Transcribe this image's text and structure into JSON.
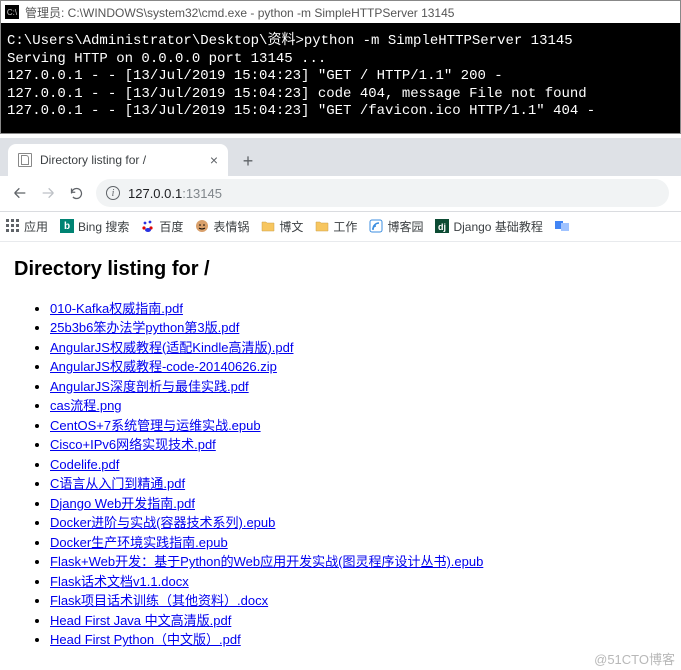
{
  "cmd": {
    "title": "管理员: C:\\WINDOWS\\system32\\cmd.exe - python  -m SimpleHTTPServer 13145",
    "line1": "C:\\Users\\Administrator\\Desktop\\资料>python -m SimpleHTTPServer 13145",
    "line2": "Serving HTTP on 0.0.0.0 port 13145 ...",
    "line3": "127.0.0.1 - - [13/Jul/2019 15:04:23] \"GET / HTTP/1.1\" 200 -",
    "line4": "127.0.0.1 - - [13/Jul/2019 15:04:23] code 404, message File not found",
    "line5": "127.0.0.1 - - [13/Jul/2019 15:04:23] \"GET /favicon.ico HTTP/1.1\" 404 -"
  },
  "browser": {
    "tab_title": "Directory listing for /",
    "url_host": "127.0.0.1",
    "url_port": ":13145",
    "bookmarks": {
      "apps": "应用",
      "bing": "Bing 搜索",
      "baidu": "百度",
      "biaoqing": "表情锅",
      "bowen": "博文",
      "gongzuo": "工作",
      "bokeyuan": "博客园",
      "django": "Django 基础教程"
    }
  },
  "page": {
    "heading": "Directory listing for /",
    "files": [
      "010-Kafka权威指南.pdf",
      "25b3b6笨办法学python第3版.pdf",
      "AngularJS权威教程(适配Kindle高清版).pdf",
      "AngularJS权威教程-code-20140626.zip",
      "AngularJS深度剖析与最佳实践.pdf",
      "cas流程.png",
      "CentOS+7系统管理与运维实战.epub",
      "Cisco+IPv6网络实现技术.pdf",
      "Codelife.pdf",
      "C语言从入门到精通.pdf",
      "Django Web开发指南.pdf",
      "Docker进阶与实战(容器技术系列).epub",
      "Docker生产环境实践指南.epub",
      "Flask+Web开发：基于Python的Web应用开发实战(图灵程序设计丛书).epub",
      "Flask话术文档v1.1.docx",
      "Flask项目话术训练（其他资料）.docx",
      "Head First Java 中文高清版.pdf",
      "Head First Python（中文版）.pdf"
    ]
  },
  "watermark": "@51CTO博客"
}
